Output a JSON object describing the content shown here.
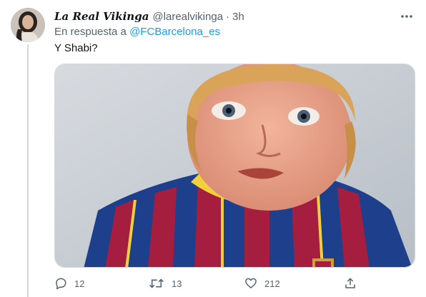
{
  "tweet": {
    "display_name": "La Real Vikinga",
    "handle": "@larealvikinga",
    "separator": "·",
    "time": "3h",
    "reply_prefix": "En respuesta a",
    "reply_mention": "@FCBarcelona_es",
    "text": "Y Shabi?"
  },
  "actions": {
    "replies": "12",
    "retweets": "13",
    "likes": "212"
  },
  "icons": [
    "more-icon",
    "reply-icon",
    "retweet-icon",
    "like-icon",
    "share-icon"
  ],
  "colors": {
    "accent": "#1d9bf0",
    "secondary_text": "#536471",
    "border": "#cfd9de"
  }
}
